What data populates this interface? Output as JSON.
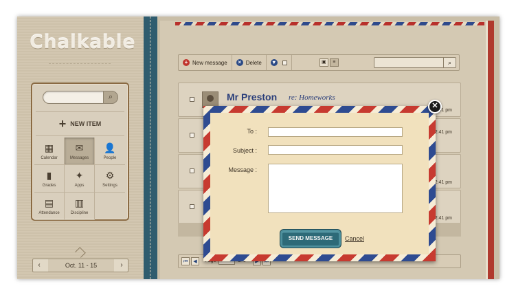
{
  "app": {
    "logo": "Chalkable"
  },
  "sidebar": {
    "new_item_label": "NEW ITEM",
    "tiles": [
      {
        "label": "Calendar",
        "icon": "calendar-icon",
        "glyph": "▦"
      },
      {
        "label": "Messages",
        "icon": "envelope-icon",
        "glyph": "✉"
      },
      {
        "label": "People",
        "icon": "person-icon",
        "glyph": "👤"
      },
      {
        "label": "Grades",
        "icon": "bar-chart-icon",
        "glyph": "▮"
      },
      {
        "label": "Apps",
        "icon": "apps-icon",
        "glyph": "✦"
      },
      {
        "label": "Settings",
        "icon": "gear-icon",
        "glyph": "⚙"
      },
      {
        "label": "Attendance",
        "icon": "attendance-icon",
        "glyph": "▤"
      },
      {
        "label": "Discipline",
        "icon": "book-icon",
        "glyph": "▥"
      }
    ],
    "active_tile": "Messages",
    "calendar_range": "Oct. 11 - 15"
  },
  "toolbar": {
    "new_message_label": "New message",
    "delete_label": "Delete"
  },
  "messages": {
    "first_sender": "Mr Preston",
    "first_subject": "re: Homeworks",
    "times": [
      "2:41 pm",
      "2:41 pm",
      "2:41 pm",
      "2:41 pm",
      "2:41 pm"
    ]
  },
  "pager": {
    "page_label": "Page",
    "of_label": "of 1"
  },
  "compose_modal": {
    "to_label": "To :",
    "subject_label": "Subject :",
    "message_label": "Message :",
    "to_value": "",
    "subject_value": "",
    "message_value": "",
    "send_label": "SEND MESSAGE",
    "cancel_label": "Cancel",
    "close_glyph": "✕"
  },
  "colors": {
    "airmail_red": "#c73a30",
    "airmail_blue": "#2e4b91",
    "send_button": "#2d6a78"
  }
}
